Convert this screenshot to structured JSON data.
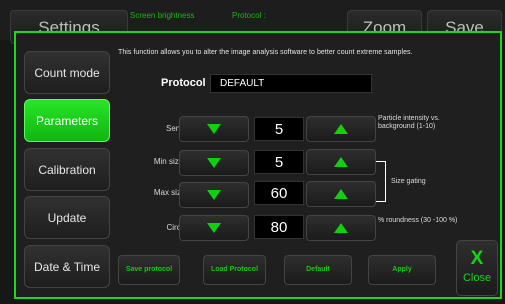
{
  "background": {
    "settings_label": "Settings",
    "screen_brightness_label": "Screen brightness",
    "protocol_label": "Protocol :",
    "zoom_label": "Zoom",
    "save_label": "Save"
  },
  "sidebar": {
    "items": [
      {
        "label": "Count mode",
        "active": false
      },
      {
        "label": "Parameters",
        "active": true
      },
      {
        "label": "Calibration",
        "active": false
      },
      {
        "label": "Update",
        "active": false
      },
      {
        "label": "Date & Time",
        "active": false
      }
    ]
  },
  "description": "This function allows you to alter the image analysis software to better count extreme samples.",
  "protocol": {
    "label": "Protocol",
    "value": "DEFAULT"
  },
  "params": {
    "sensitivity": {
      "label": "Sensitivity",
      "value": "5"
    },
    "min_size": {
      "label": "Min size (µm)",
      "value": "5"
    },
    "max_size": {
      "label": "Max size(µm)",
      "value": "60"
    },
    "circularity": {
      "label": "Circularity",
      "value": "80"
    }
  },
  "notes": {
    "sensitivity": "Particle intensity vs. background (1-10)",
    "size_gating": "Size gating",
    "circularity": "% roundness (30 -100 %)"
  },
  "actions": {
    "save_protocol": "Save protocol",
    "load_protocol": "Load Protocol",
    "default": "Default",
    "apply": "Apply"
  },
  "close": {
    "x": "X",
    "label": "Close"
  },
  "colors": {
    "accent": "#1fd61f",
    "panel": "#1f1f1f",
    "value_box": "#000000"
  },
  "icons": {
    "decrease": "triangle-down-icon",
    "increase": "triangle-up-icon"
  }
}
